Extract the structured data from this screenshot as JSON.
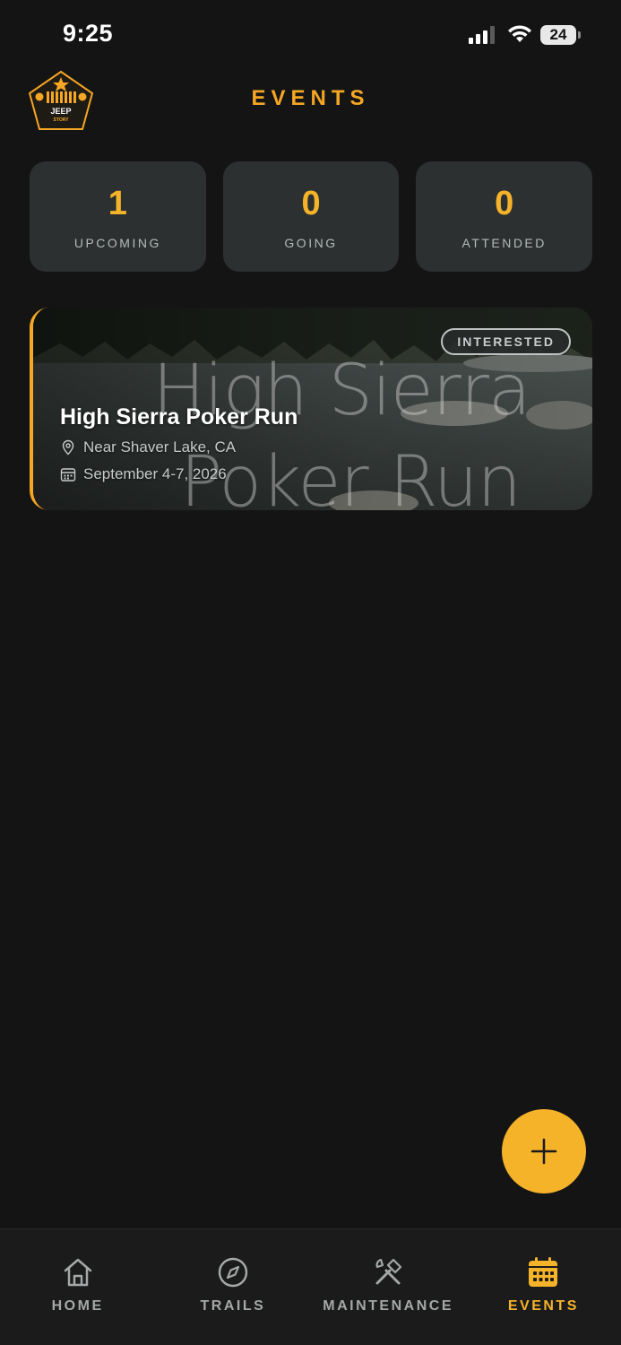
{
  "status_bar": {
    "time": "9:25",
    "battery": "24"
  },
  "header": {
    "title": "EVENTS",
    "logo": {
      "line1": "JEEP",
      "line2": "STORY"
    }
  },
  "stats": [
    {
      "value": "1",
      "label": "UPCOMING"
    },
    {
      "value": "0",
      "label": "GOING"
    },
    {
      "value": "0",
      "label": "ATTENDED"
    }
  ],
  "events": [
    {
      "title": "High Sierra Poker Run",
      "bg_line1": "High Sierra",
      "bg_line2": "Poker Run",
      "status": "INTERESTED",
      "location": "Near Shaver Lake, CA",
      "date": "September 4-7, 2026"
    }
  ],
  "tabs": [
    {
      "label": "HOME",
      "icon": "home-icon"
    },
    {
      "label": "TRAILS",
      "icon": "compass-icon"
    },
    {
      "label": "MAINTENANCE",
      "icon": "tools-icon"
    },
    {
      "label": "EVENTS",
      "icon": "calendar-icon",
      "active": true
    }
  ],
  "colors": {
    "accent": "#f5b32a",
    "background": "#141414",
    "card": "#2c3030"
  }
}
